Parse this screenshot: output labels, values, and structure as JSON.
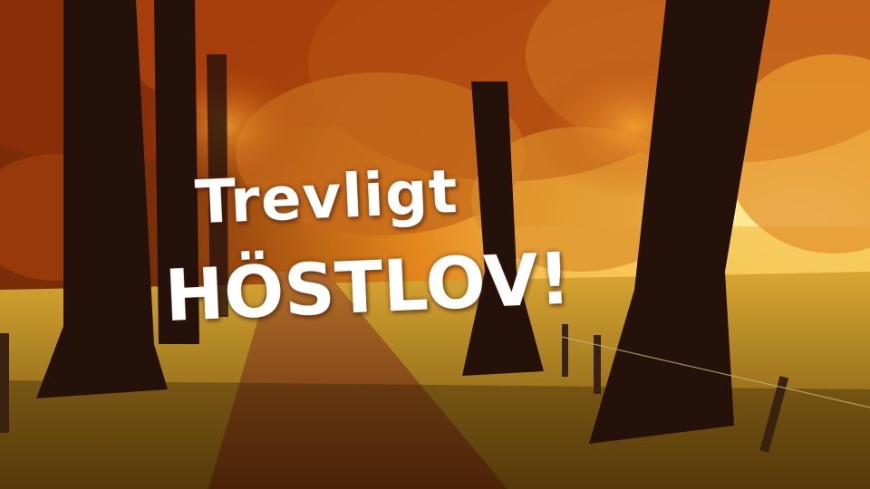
{
  "headline": {
    "line1": "Trevligt",
    "line2": "HÖSTLOV!"
  },
  "scene": {
    "description_icon": "autumn-tree-lined-path",
    "colors": {
      "sky_glow": "#ffd86a",
      "foliage_dark": "#7a2a08",
      "foliage_light": "#e07a1a",
      "trunk": "#2a1408",
      "grass": "#b58a1c",
      "path": "#7a3a14",
      "text": "#ffffff"
    }
  }
}
